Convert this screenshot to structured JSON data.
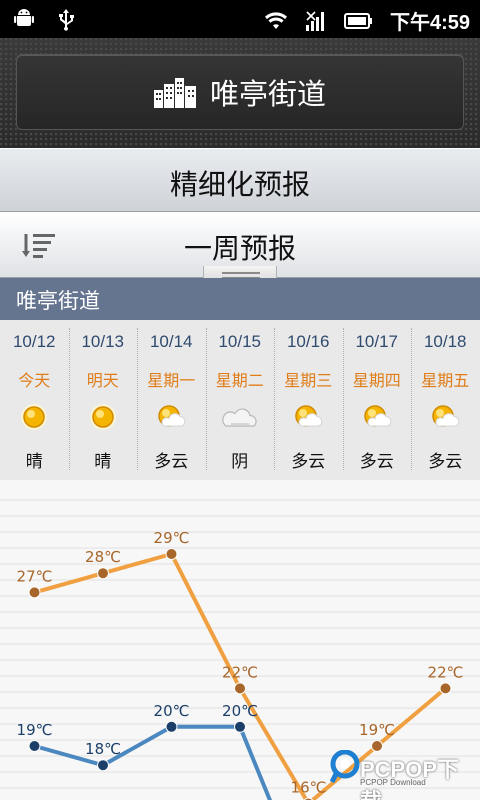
{
  "status_bar": {
    "time": "下午4:59",
    "left_icons": [
      "android-icon",
      "usb-icon"
    ],
    "right_icons": [
      "wifi-icon",
      "signal-icon",
      "battery-icon"
    ]
  },
  "header": {
    "city_title": "唯亭街道",
    "icon": "city-buildings-icon"
  },
  "bars": {
    "fine_forecast": "精细化预报",
    "week_forecast": "一周预报",
    "sort_icon": "list-sort-icon"
  },
  "city_strip": {
    "name": "唯亭街道"
  },
  "forecast": {
    "days": [
      {
        "date": "10/12",
        "day": "今天",
        "cond": "晴",
        "icon": "sun-icon"
      },
      {
        "date": "10/13",
        "day": "明天",
        "cond": "晴",
        "icon": "sun-icon"
      },
      {
        "date": "10/14",
        "day": "星期一",
        "cond": "多云",
        "icon": "partly-cloudy-icon"
      },
      {
        "date": "10/15",
        "day": "星期二",
        "cond": "阴",
        "icon": "cloud-icon"
      },
      {
        "date": "10/16",
        "day": "星期三",
        "cond": "多云",
        "icon": "partly-cloudy-icon"
      },
      {
        "date": "10/17",
        "day": "星期四",
        "cond": "多云",
        "icon": "partly-cloudy-icon"
      },
      {
        "date": "10/18",
        "day": "星期五",
        "cond": "多云",
        "icon": "partly-cloudy-icon"
      }
    ]
  },
  "chart_data": {
    "type": "line",
    "categories": [
      "10/12",
      "10/13",
      "10/14",
      "10/15",
      "10/16",
      "10/17",
      "10/18"
    ],
    "series": [
      {
        "values": [
          27,
          28,
          29,
          22,
          16,
          19,
          22
        ],
        "labels": [
          "27℃",
          "28℃",
          "29℃",
          "22℃",
          "16℃",
          "19℃",
          "22℃"
        ],
        "color": "#f0a040"
      },
      {
        "values": [
          19,
          18,
          20,
          20,
          null,
          null,
          null
        ],
        "labels": [
          "19℃",
          "18℃",
          "20℃",
          "20℃",
          "",
          "",
          ""
        ],
        "color": "#4b88c0"
      }
    ],
    "colors": {
      "high": "#f0a040",
      "low": "#4b88c0",
      "high_marker": "#a8662a",
      "low_marker": "#1b3f68"
    }
  },
  "watermark": {
    "text": "PCPOP下载",
    "sub": "PCPOP Download"
  }
}
